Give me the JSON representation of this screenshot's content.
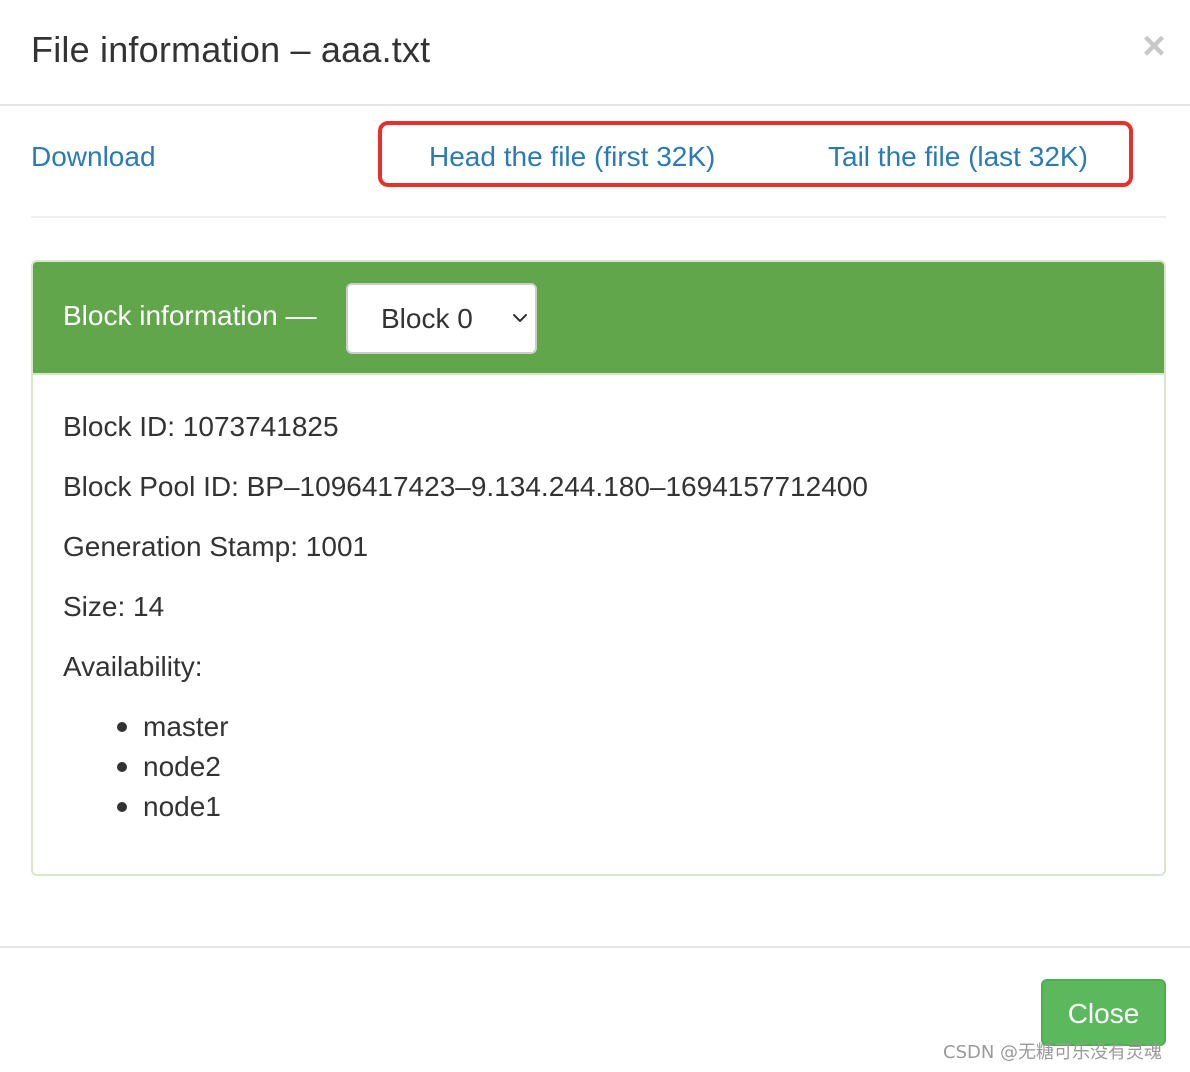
{
  "modal": {
    "title": "File information – aaa.txt",
    "close_symbol": "×",
    "close_icon": "close-icon"
  },
  "links": {
    "download": "Download",
    "head": "Head the file (first 32K)",
    "tail": "Tail the file (last 32K)"
  },
  "annotation": {
    "highlight_color": "#e8302b"
  },
  "panel": {
    "heading_label": "Block information ––",
    "heading_color": "#62a64c",
    "select_value": "Block 0",
    "select_icon": "chevron-down-icon",
    "details": {
      "block_id": "Block ID: 1073741825",
      "block_pool_id": "Block Pool ID: BP–1096417423–9.134.244.180–1694157712400",
      "generation_stamp": "Generation Stamp: 1001",
      "size": "Size: 14",
      "availability_label": "Availability:"
    },
    "availability": [
      "master",
      "node2",
      "node1"
    ]
  },
  "footer": {
    "close_label": "Close",
    "close_color": "#5cb85c"
  },
  "watermark": "CSDN @无糖可乐没有灵魂"
}
